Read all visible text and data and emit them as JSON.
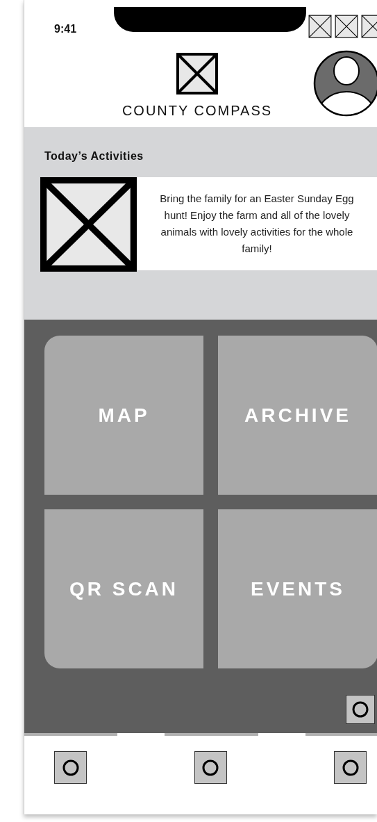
{
  "status_bar": {
    "time": "9:41"
  },
  "header": {
    "title": "COUNTY COMPASS"
  },
  "activities": {
    "heading": "Today’s Activities",
    "description": "Bring the family for an Easter Sunday Egg hunt! Enjoy the farm and all of the lovely animals with lovely activities for the whole family!"
  },
  "tiles": [
    {
      "label": "MAP"
    },
    {
      "label": "ARCHIVE"
    },
    {
      "label": "QR SCAN"
    },
    {
      "label": "EVENTS"
    }
  ]
}
